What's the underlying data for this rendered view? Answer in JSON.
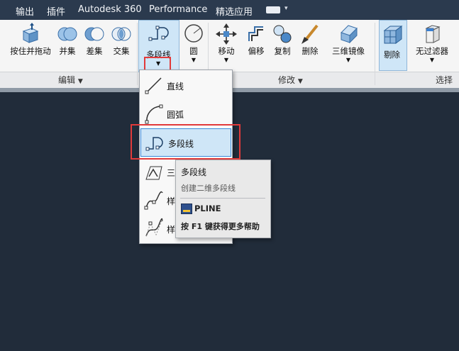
{
  "menubar": {
    "items": [
      "输出",
      "插件",
      "Autodesk 360",
      "Performance",
      "精选应用"
    ],
    "caret": "▾"
  },
  "ribbon": {
    "edit_panel": {
      "title": "编辑",
      "buttons": [
        "按住并拖动",
        "并集",
        "差集",
        "交集"
      ]
    },
    "draw": {
      "polyline": {
        "label": "多段线"
      },
      "circle": {
        "label": "圆"
      }
    },
    "modify_panel": {
      "title": "修改",
      "buttons": [
        "移动",
        "偏移",
        "复制",
        "删除",
        "三维镜像"
      ]
    },
    "selection_panel": {
      "title": "选择",
      "buttons": [
        "剔除",
        "无过滤器"
      ]
    },
    "panel_caret": "▼"
  },
  "dropdown": {
    "items": [
      "直线",
      "圆弧",
      "多段线",
      "三",
      "样",
      "样"
    ]
  },
  "tooltip": {
    "title": "多段线",
    "description": "创建二维多段线",
    "command": "PLINE",
    "help": "按 F1 键获得更多帮助"
  },
  "colors": {
    "menubar_bg": "#2b3a4e",
    "canvas_bg": "#212c3a",
    "highlight": "#cfe6f7",
    "highlight_border": "#3b8ad9",
    "callout": "#e23a3a"
  }
}
